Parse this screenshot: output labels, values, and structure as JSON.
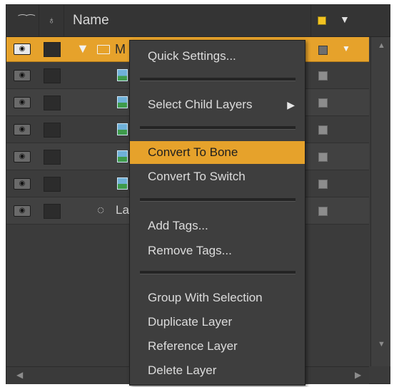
{
  "header": {
    "link_icon": "link-icon",
    "lock_icon": "lock-icon",
    "name_label": "Name",
    "color_swatch": "#f3c321",
    "dropdown_glyph": "▼"
  },
  "rows": [
    {
      "type": "group",
      "label": "M",
      "selected": true
    },
    {
      "type": "image",
      "label": ""
    },
    {
      "type": "image",
      "label": ""
    },
    {
      "type": "image",
      "label": ""
    },
    {
      "type": "image",
      "label": ""
    },
    {
      "type": "image",
      "label": ""
    },
    {
      "type": "shape",
      "label": "La"
    }
  ],
  "row_text": {
    "eye_glyph": "👁",
    "tri_glyph": "▼",
    "shape_glyph": "◌"
  },
  "menu": {
    "items": [
      {
        "label": "Quick Settings..."
      },
      {
        "label": "Select Child Layers",
        "submenu": "▶"
      },
      {
        "label": "Convert To Bone",
        "highlighted": true
      },
      {
        "label": "Convert To Switch"
      },
      {
        "label": "Add Tags..."
      },
      {
        "label": "Remove Tags..."
      },
      {
        "label": "Group With Selection"
      },
      {
        "label": "Duplicate Layer"
      },
      {
        "label": "Reference Layer"
      },
      {
        "label": "Delete Layer"
      }
    ]
  },
  "scroll": {
    "up": "▲",
    "down": "▼",
    "left": "◀",
    "right": "▶"
  },
  "colors": {
    "selection": "#e6a22b",
    "panel": "#3b3b3b",
    "menu": "#3e3e3e"
  }
}
